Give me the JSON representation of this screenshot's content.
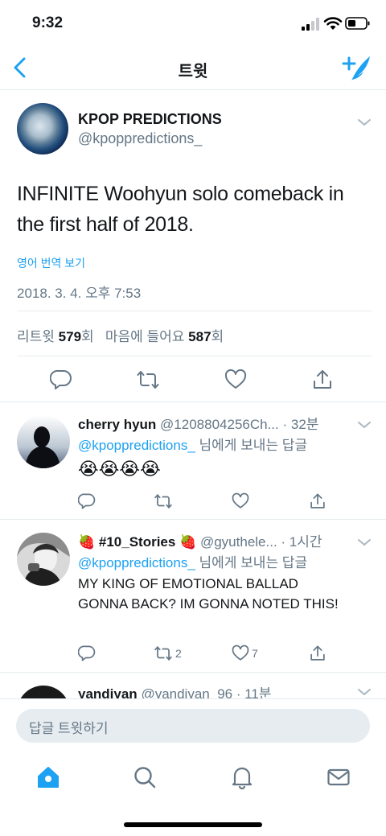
{
  "status_bar": {
    "time": "9:32"
  },
  "nav": {
    "title": "트윗"
  },
  "main_tweet": {
    "name": "KPOP PREDICTIONS",
    "handle": "@kpoppredictions_",
    "text": "INFINITE Woohyun solo comeback in the first half of 2018.",
    "translate_label": "영어 번역 보기",
    "timestamp": "2018. 3. 4. 오후 7:53",
    "retweet_label": "리트윗",
    "retweet_count": "579",
    "count_unit": "회",
    "like_label": "마음에 들어요",
    "like_count": "587"
  },
  "replies": [
    {
      "name": "cherry hyun",
      "handle": "@1208804256Ch...",
      "time": "· 32분",
      "mention": "@kpoppredictions_",
      "to_suffix": " 님에게 보내는 답글",
      "text": "😭😭😭😭",
      "retweets": "",
      "likes": ""
    },
    {
      "name": "🍓 #10_Stories 🍓",
      "handle": "@gyuthele...",
      "time": "· 1시간",
      "mention": "@kpoppredictions_",
      "to_suffix": " 님에게 보내는 답글",
      "text": "MY KING OF EMOTIONAL BALLAD GONNA BACK? IM GONNA NOTED THIS!",
      "retweets": "2",
      "likes": "7"
    },
    {
      "name": "yandiyan",
      "handle": "@yandiyan_96",
      "time": "· 11분"
    }
  ],
  "reply_input": {
    "placeholder": "답글 트윗하기"
  },
  "tab_bar": {
    "icons": [
      "home-icon",
      "search-icon",
      "notifications-icon",
      "messages-icon"
    ],
    "active": "home-icon"
  },
  "colors": {
    "accent": "#1da1f2",
    "text": "#14171a",
    "secondary": "#657786",
    "divider": "#e6ecf0"
  }
}
